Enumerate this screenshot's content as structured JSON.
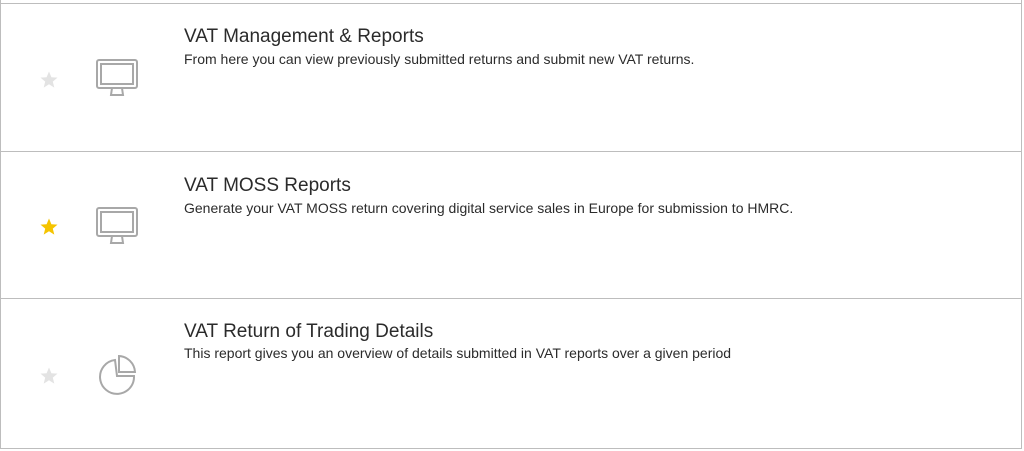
{
  "reports": [
    {
      "title": "VAT Management & Reports",
      "description": "From here you can view previously submitted returns and submit new VAT returns.",
      "favourite": false,
      "icon": "monitor-icon"
    },
    {
      "title": "VAT MOSS Reports",
      "description": "Generate your VAT MOSS return covering digital service sales in Europe for submission to HMRC.",
      "favourite": true,
      "icon": "monitor-icon"
    },
    {
      "title": "VAT Return of Trading Details",
      "description": "This report gives you an overview of details submitted in VAT reports over a given period",
      "favourite": false,
      "icon": "pie-chart-icon"
    }
  ],
  "colors": {
    "star_active": "#f5c400",
    "star_inactive": "#e3e3e3",
    "icon_stroke": "#a8a8a8",
    "divider": "#bdbdbd",
    "text": "#2b2b2b"
  }
}
